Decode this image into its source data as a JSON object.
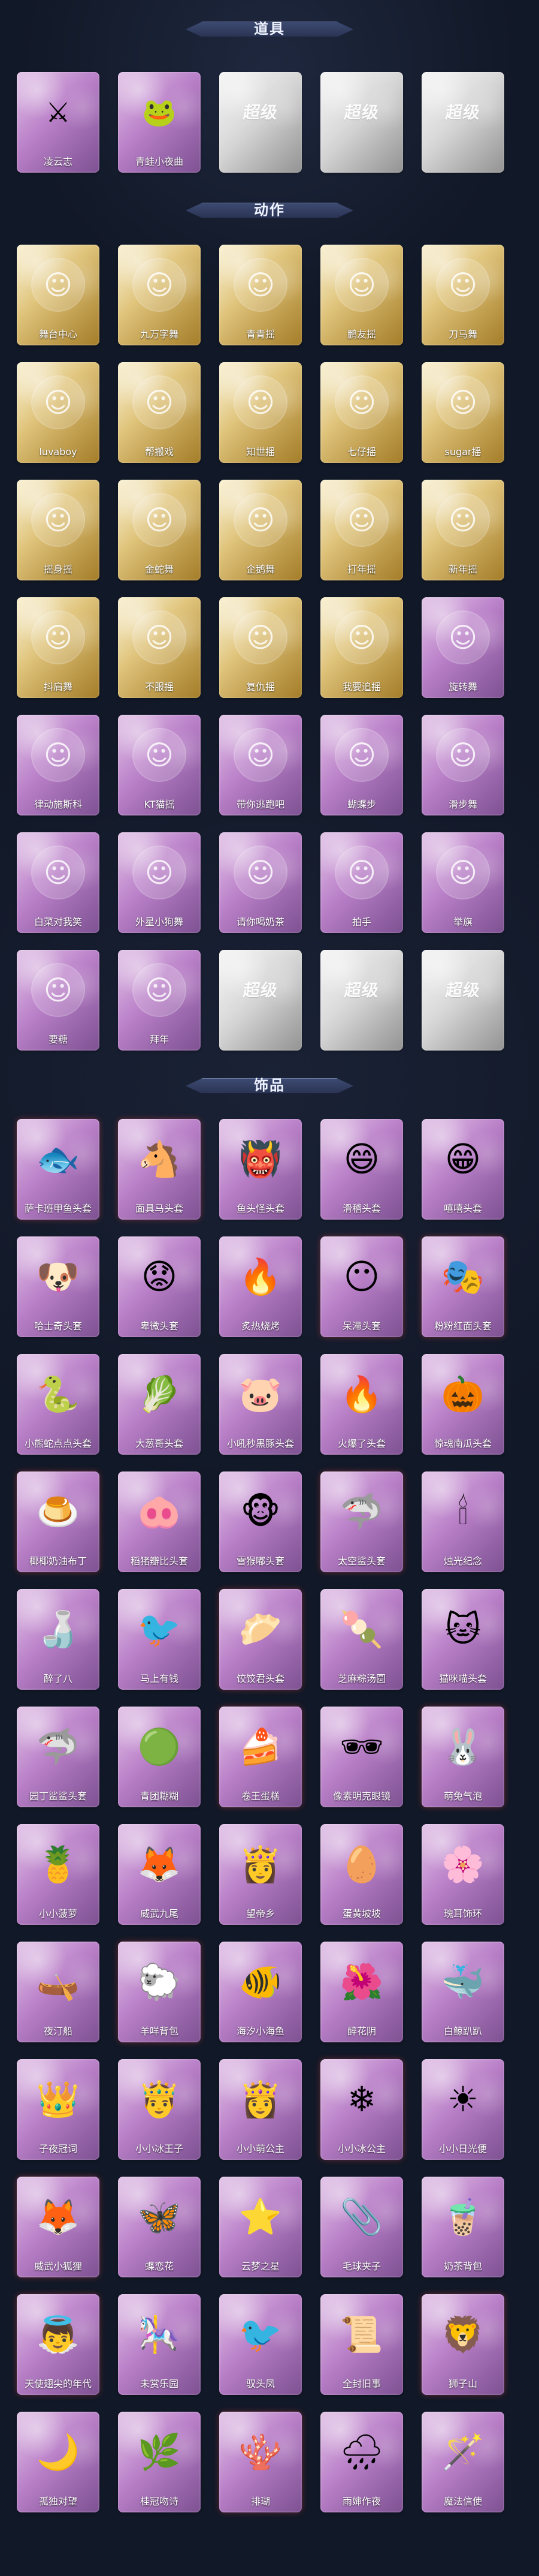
{
  "sections": [
    {
      "title": "道具",
      "items": [
        {
          "label": "凌云志",
          "icon": "sword-icon",
          "glyph": "⚔",
          "style": "purple"
        },
        {
          "label": "青蛙小夜曲",
          "icon": "frog-icon",
          "glyph": "🐸",
          "style": "purple"
        },
        {
          "label": "",
          "icon": "brand-logo-icon",
          "glyph": "超级",
          "style": "grey"
        },
        {
          "label": "",
          "icon": "brand-logo-icon",
          "glyph": "超级",
          "style": "grey"
        },
        {
          "label": "",
          "icon": "brand-logo-icon",
          "glyph": "超级",
          "style": "grey"
        }
      ]
    },
    {
      "title": "动作",
      "items": [
        {
          "label": "舞台中心",
          "icon": "dance-icon",
          "glyph": "☺",
          "style": "gold"
        },
        {
          "label": "九万字舞",
          "icon": "dance-icon",
          "glyph": "☺",
          "style": "gold"
        },
        {
          "label": "青青摇",
          "icon": "dance-icon",
          "glyph": "☺",
          "style": "gold"
        },
        {
          "label": "鹏友摇",
          "icon": "dance-icon",
          "glyph": "☺",
          "style": "gold"
        },
        {
          "label": "刀马舞",
          "icon": "dance-icon",
          "glyph": "☺",
          "style": "gold"
        },
        {
          "label": "luvaboy",
          "icon": "dance-icon",
          "glyph": "☺",
          "style": "gold"
        },
        {
          "label": "帮搬戏",
          "icon": "dance-icon",
          "glyph": "☺",
          "style": "gold"
        },
        {
          "label": "知世摇",
          "icon": "dance-icon",
          "glyph": "☺",
          "style": "gold"
        },
        {
          "label": "七仔摇",
          "icon": "dance-icon",
          "glyph": "☺",
          "style": "gold"
        },
        {
          "label": "sugar摇",
          "icon": "dance-icon",
          "glyph": "☺",
          "style": "gold"
        },
        {
          "label": "摇身摇",
          "icon": "dance-icon",
          "glyph": "☺",
          "style": "gold"
        },
        {
          "label": "金蛇舞",
          "icon": "dance-icon",
          "glyph": "☺",
          "style": "gold"
        },
        {
          "label": "企鹅舞",
          "icon": "dance-icon",
          "glyph": "☺",
          "style": "gold"
        },
        {
          "label": "打年摇",
          "icon": "dance-icon",
          "glyph": "☺",
          "style": "gold"
        },
        {
          "label": "新年摇",
          "icon": "dance-icon",
          "glyph": "☺",
          "style": "gold"
        },
        {
          "label": "抖肩舞",
          "icon": "dance-icon",
          "glyph": "☺",
          "style": "gold"
        },
        {
          "label": "不服摇",
          "icon": "dance-icon",
          "glyph": "☺",
          "style": "gold"
        },
        {
          "label": "复仇摇",
          "icon": "dance-icon",
          "glyph": "☺",
          "style": "gold"
        },
        {
          "label": "我要追摇",
          "icon": "dance-icon",
          "glyph": "☺",
          "style": "gold"
        },
        {
          "label": "旋转舞",
          "icon": "dance-icon",
          "glyph": "☺",
          "style": "purple"
        },
        {
          "label": "律动施斯科",
          "icon": "dance-icon",
          "glyph": "☺",
          "style": "purple"
        },
        {
          "label": "KT猫摇",
          "icon": "dance-icon",
          "glyph": "☺",
          "style": "purple"
        },
        {
          "label": "带你逃跑吧",
          "icon": "dance-icon",
          "glyph": "☺",
          "style": "purple"
        },
        {
          "label": "蝴蝶步",
          "icon": "dance-icon",
          "glyph": "☺",
          "style": "purple"
        },
        {
          "label": "滑步舞",
          "icon": "dance-icon",
          "glyph": "☺",
          "style": "purple"
        },
        {
          "label": "白菜对我笑",
          "icon": "dance-icon",
          "glyph": "☺",
          "style": "purple"
        },
        {
          "label": "外星小狗舞",
          "icon": "dance-icon",
          "glyph": "☺",
          "style": "purple"
        },
        {
          "label": "请你喝奶茶",
          "icon": "dance-icon",
          "glyph": "☺",
          "style": "purple"
        },
        {
          "label": "拍手",
          "icon": "dance-icon",
          "glyph": "☺",
          "style": "purple"
        },
        {
          "label": "举旗",
          "icon": "dance-icon",
          "glyph": "☺",
          "style": "purple"
        },
        {
          "label": "要糖",
          "icon": "dance-icon",
          "glyph": "☺",
          "style": "purple"
        },
        {
          "label": "拜年",
          "icon": "dance-icon",
          "glyph": "☺",
          "style": "purple"
        },
        {
          "label": "",
          "icon": "brand-logo-icon",
          "glyph": "超级",
          "style": "grey"
        },
        {
          "label": "",
          "icon": "brand-logo-icon",
          "glyph": "超级",
          "style": "grey"
        },
        {
          "label": "",
          "icon": "brand-logo-icon",
          "glyph": "超级",
          "style": "grey"
        }
      ]
    },
    {
      "title": "饰品",
      "items": [
        {
          "label": "萨卡班甲鱼头套",
          "icon": "fish-icon",
          "glyph": "🐟",
          "style": "purple"
        },
        {
          "label": "面具马头套",
          "icon": "horse-icon",
          "glyph": "🐴",
          "style": "purple"
        },
        {
          "label": "鱼头怪头套",
          "icon": "monster-icon",
          "glyph": "👹",
          "style": "purple"
        },
        {
          "label": "滑稽头套",
          "icon": "smile-icon",
          "glyph": "😄",
          "style": "purple"
        },
        {
          "label": "嘻嘻头套",
          "icon": "grin-icon",
          "glyph": "😁",
          "style": "purple"
        },
        {
          "label": "哈士奇头套",
          "icon": "dog-icon",
          "glyph": "🐶",
          "style": "purple"
        },
        {
          "label": "卑微头套",
          "icon": "sad-icon",
          "glyph": "😟",
          "style": "purple"
        },
        {
          "label": "炙热烧烤",
          "icon": "fire-icon",
          "glyph": "🔥",
          "style": "purple"
        },
        {
          "label": "呆滞头套",
          "icon": "face-icon",
          "glyph": "😶",
          "style": "purple"
        },
        {
          "label": "粉粉红面头套",
          "icon": "mask-icon",
          "glyph": "🎭",
          "style": "purple"
        },
        {
          "label": "小熊蛇点点头套",
          "icon": "snake-icon",
          "glyph": "🐍",
          "style": "purple"
        },
        {
          "label": "大葱哥头套",
          "icon": "leek-icon",
          "glyph": "🥬",
          "style": "purple"
        },
        {
          "label": "小吼秒黑豚头套",
          "icon": "pig-icon",
          "glyph": "🐷",
          "style": "purple"
        },
        {
          "label": "火爆了头套",
          "icon": "fire-icon",
          "glyph": "🔥",
          "style": "purple"
        },
        {
          "label": "惊魂南瓜头套",
          "icon": "pumpkin-icon",
          "glyph": "🎃",
          "style": "purple"
        },
        {
          "label": "椰椰奶油布丁",
          "icon": "pudding-icon",
          "glyph": "🍮",
          "style": "purple"
        },
        {
          "label": "稻猪瓣比头套",
          "icon": "pig-icon",
          "glyph": "🐽",
          "style": "purple"
        },
        {
          "label": "雪猴嘟头套",
          "icon": "monkey-icon",
          "glyph": "🐵",
          "style": "purple"
        },
        {
          "label": "太空鲨头套",
          "icon": "shark-icon",
          "glyph": "🦈",
          "style": "purple"
        },
        {
          "label": "烛光纪念",
          "icon": "candle-icon",
          "glyph": "🕯",
          "style": "purple"
        },
        {
          "label": "醉了八",
          "icon": "drunk-icon",
          "glyph": "🍶",
          "style": "purple"
        },
        {
          "label": "马上有钱",
          "icon": "bird-icon",
          "glyph": "🐦",
          "style": "purple"
        },
        {
          "label": "饺饺君头套",
          "icon": "dumpling-icon",
          "glyph": "🥟",
          "style": "purple"
        },
        {
          "label": "芝麻粽汤圆",
          "icon": "rice-ball-icon",
          "glyph": "🍡",
          "style": "purple"
        },
        {
          "label": "猫咪喵头套",
          "icon": "cat-icon",
          "glyph": "🐱",
          "style": "purple"
        },
        {
          "label": "园丁鲨鲨头套",
          "icon": "shark-icon",
          "glyph": "🦈",
          "style": "purple"
        },
        {
          "label": "青团糊糊",
          "icon": "bun-icon",
          "glyph": "🟢",
          "style": "purple"
        },
        {
          "label": "卷王蛋糕",
          "icon": "cake-icon",
          "glyph": "🍰",
          "style": "purple"
        },
        {
          "label": "像素明克眼镜",
          "icon": "glasses-icon",
          "glyph": "🕶",
          "style": "purple"
        },
        {
          "label": "萌兔气泡",
          "icon": "rabbit-icon",
          "glyph": "🐰",
          "style": "purple"
        },
        {
          "label": "小小菠萝",
          "icon": "pineapple-icon",
          "glyph": "🍍",
          "style": "purple"
        },
        {
          "label": "威武九尾",
          "icon": "fox-icon",
          "glyph": "🦊",
          "style": "purple"
        },
        {
          "label": "望帝乡",
          "icon": "doll-icon",
          "glyph": "👸",
          "style": "purple"
        },
        {
          "label": "蛋黄坡坡",
          "icon": "egg-icon",
          "glyph": "🥚",
          "style": "purple"
        },
        {
          "label": "瑰耳饰环",
          "icon": "flower-icon",
          "glyph": "🌸",
          "style": "purple"
        },
        {
          "label": "夜汀船",
          "icon": "boat-icon",
          "glyph": "🛶",
          "style": "purple"
        },
        {
          "label": "羊咩背包",
          "icon": "sheep-icon",
          "glyph": "🐑",
          "style": "purple"
        },
        {
          "label": "海汐小海鱼",
          "icon": "fish-icon",
          "glyph": "🐠",
          "style": "purple"
        },
        {
          "label": "醉花阴",
          "icon": "flower-icon",
          "glyph": "🌺",
          "style": "purple"
        },
        {
          "label": "白鲸趴趴",
          "icon": "whale-icon",
          "glyph": "🐳",
          "style": "purple"
        },
        {
          "label": "子夜冠词",
          "icon": "crown-icon",
          "glyph": "👑",
          "style": "purple"
        },
        {
          "label": "小小冰王子",
          "icon": "prince-icon",
          "glyph": "🤴",
          "style": "purple"
        },
        {
          "label": "小小萌公主",
          "icon": "princess-icon",
          "glyph": "👸",
          "style": "purple"
        },
        {
          "label": "小小冰公主",
          "icon": "ice-princess-icon",
          "glyph": "❄",
          "style": "purple"
        },
        {
          "label": "小小日光便",
          "icon": "sun-icon",
          "glyph": "☀",
          "style": "purple"
        },
        {
          "label": "威武小狐狸",
          "icon": "fox-icon",
          "glyph": "🦊",
          "style": "purple"
        },
        {
          "label": "蝶恋花",
          "icon": "butterfly-icon",
          "glyph": "🦋",
          "style": "purple"
        },
        {
          "label": "云梦之星",
          "icon": "star-icon",
          "glyph": "⭐",
          "style": "purple"
        },
        {
          "label": "毛球夹子",
          "icon": "clip-icon",
          "glyph": "📎",
          "style": "purple"
        },
        {
          "label": "奶茶背包",
          "icon": "drink-icon",
          "glyph": "🧋",
          "style": "purple"
        },
        {
          "label": "天使翅尖的年代",
          "icon": "angel-icon",
          "glyph": "👼",
          "style": "purple"
        },
        {
          "label": "未赏乐园",
          "icon": "park-icon",
          "glyph": "🎠",
          "style": "purple"
        },
        {
          "label": "驭头凤",
          "icon": "phoenix-icon",
          "glyph": "🐦",
          "style": "purple"
        },
        {
          "label": "全封旧事",
          "icon": "scroll-icon",
          "glyph": "📜",
          "style": "purple"
        },
        {
          "label": "狮子山",
          "icon": "lion-icon",
          "glyph": "🦁",
          "style": "purple"
        },
        {
          "label": "孤独对望",
          "icon": "moon-icon",
          "glyph": "🌙",
          "style": "purple"
        },
        {
          "label": "桂冠吻诗",
          "icon": "laurel-icon",
          "glyph": "🌿",
          "style": "purple"
        },
        {
          "label": "排瑚",
          "icon": "coral-icon",
          "glyph": "🪸",
          "style": "purple"
        },
        {
          "label": "雨婶作夜",
          "icon": "rain-icon",
          "glyph": "🌧",
          "style": "purple"
        },
        {
          "label": "魔法信使",
          "icon": "wand-icon",
          "glyph": "🪄",
          "style": "purple"
        }
      ]
    }
  ]
}
